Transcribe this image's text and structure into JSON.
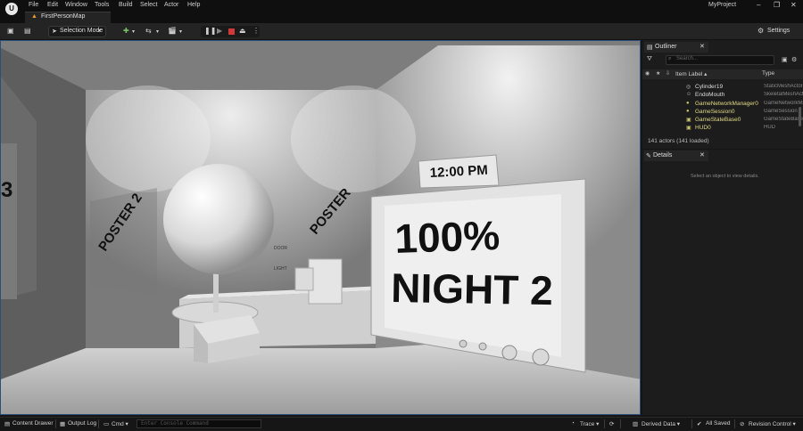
{
  "app": {
    "logo_glyph": "U",
    "project_name": "MyProject",
    "document_tab": "FirstPersonMap",
    "menu": [
      "File",
      "Edit",
      "Window",
      "Tools",
      "Build",
      "Select",
      "Actor",
      "Help"
    ],
    "window_controls": {
      "minimize": "–",
      "maximize": "❐",
      "close": "✕"
    }
  },
  "toolbar": {
    "mode_label": "Selection Mode",
    "settings_label": "Settings",
    "icons": [
      "save-icon",
      "content-icon",
      "add-actor-icon",
      "blueprint-icon",
      "cinematics-icon",
      "pause-icon",
      "advance-frame-icon",
      "stop-icon",
      "eject-icon",
      "more-icon",
      "settings-icon"
    ]
  },
  "viewport": {
    "scene_text": {
      "poster_left": "POSTER 2",
      "poster_right": "POSTER",
      "edge_number": "3",
      "clock": "12:00 PM",
      "power": "100%",
      "night": "NIGHT 2",
      "door_label": "DOOR",
      "light_label": "LIGHT"
    }
  },
  "outliner": {
    "title": "Outliner",
    "close": "✕",
    "search_placeholder": "Search...",
    "col_label": "Item Label ▴",
    "col_type": "Type",
    "rows": [
      {
        "label": "Cylinder19",
        "type": "StaticMeshActor",
        "icon": "◎"
      },
      {
        "label": "EndoMouth",
        "type": "SkeletalMeshActor",
        "icon": "☺"
      },
      {
        "label": "GameNetworkManager0",
        "type": "GameNetworkManager",
        "icon": "●"
      },
      {
        "label": "GameSession0",
        "type": "GameSession",
        "icon": "●"
      },
      {
        "label": "GameStateBase0",
        "type": "GameStateBase",
        "icon": "▣"
      },
      {
        "label": "HUD0",
        "type": "HUD",
        "icon": "▣"
      }
    ],
    "actor_count": "141 actors (141 loaded)"
  },
  "details": {
    "title": "Details",
    "close": "✕",
    "hint": "Select an object to view details."
  },
  "statusbar": {
    "content_drawer": "Content Drawer",
    "output_log": "Output Log",
    "cmd": "Cmd ▾",
    "console_placeholder": "Enter Console Command",
    "trace": "Trace ▾",
    "derived_data": "Derived Data ▾",
    "all_saved": "All Saved",
    "revision_control": "Revision Control ▾"
  },
  "colors": {
    "accent_outline": "#2b4f78",
    "stop_red": "#d23a3a",
    "tab_icon": "#e0a030"
  }
}
